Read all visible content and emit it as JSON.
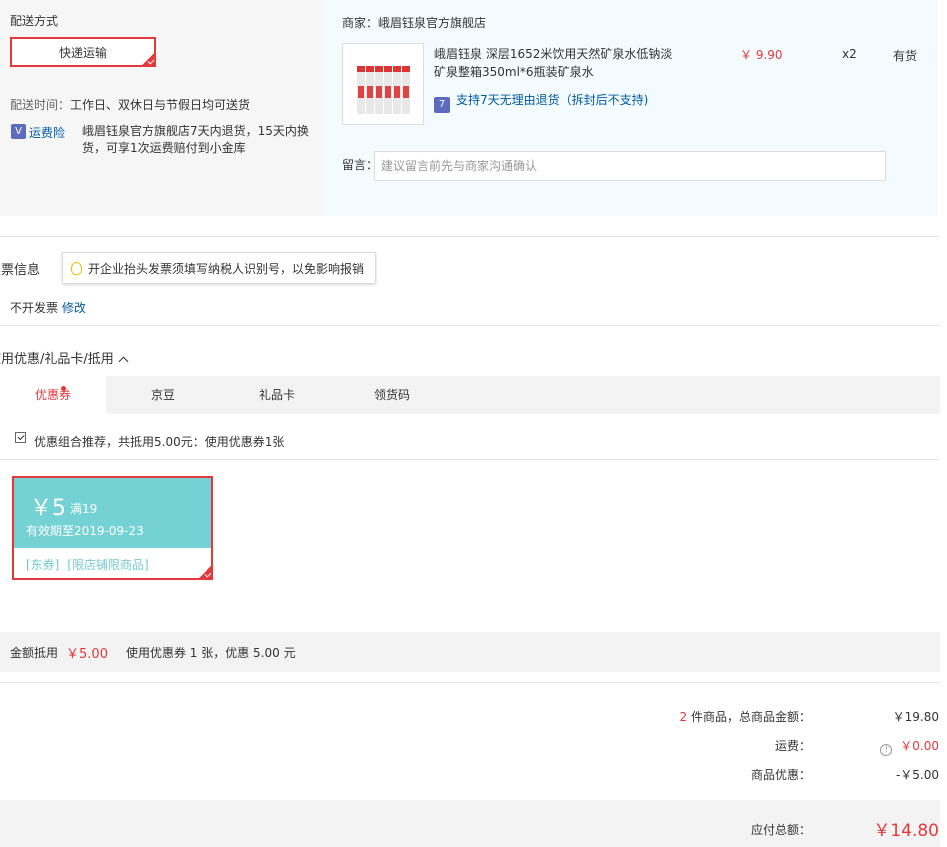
{
  "shipping": {
    "section_label": "配送方式",
    "method": "快递运输",
    "time_label": "配送时间：",
    "time_value": "工作日、双休日与节假日均可送货",
    "insurance_link": "运费险",
    "insurance_desc_line1": "峨眉钰泉官方旗舰店7天内退货，15天内换",
    "insurance_desc_line2": "货，可享1次运费赔付到小金库"
  },
  "merchant": {
    "label": "商家：",
    "name": "峨眉钰泉官方旗舰店",
    "product": {
      "title_line1": "峨眉钰泉 深层1652米饮用天然矿泉水低钠淡",
      "title_line2": "矿泉整箱350ml*6瓶装矿泉水",
      "price": "￥ 9.90",
      "quantity": "x2",
      "stock": "有货",
      "return_policy": "支持7天无理由退货（拆封后不支持)"
    },
    "note_label": "留言：",
    "note_placeholder": "建议留言前先与商家沟通确认"
  },
  "invoice": {
    "title": "发票信息",
    "tip": "开企业抬头发票须填写纳税人识别号，以免影响报销",
    "status": "不开发票",
    "edit": "修改"
  },
  "discount": {
    "title": "使用优惠/礼品卡/抵用",
    "tabs": [
      {
        "label": "优惠券"
      },
      {
        "label": "京豆"
      },
      {
        "label": "礼品卡"
      },
      {
        "label": "领货码"
      }
    ],
    "combo_text": "优惠组合推荐，共抵用5.00元：使用优惠券1张",
    "coupon": {
      "amount": "￥5",
      "condition": "满19",
      "validity": "有效期至2019-09-23",
      "tag1": "[东券]",
      "tag2": "[限店铺限商品]"
    },
    "summary_label": "金额抵用",
    "summary_amount": "￥5.00",
    "summary_detail": "使用优惠券 1 张，优惠 5.00 元"
  },
  "totals": {
    "count": "2",
    "count_suffix": "件商品，总商品金额：",
    "goods_amount": "￥19.80",
    "freight_label": "运费：",
    "freight_amount": "￥0.00",
    "discount_label": "商品优惠：",
    "discount_amount": "-￥5.00",
    "payable_label": "应付总额：",
    "payable_amount": "￥14.80"
  },
  "colors": {
    "accent_red": "#e4393c",
    "link_blue": "#005aa0",
    "coupon_teal": "#74d2d4"
  }
}
